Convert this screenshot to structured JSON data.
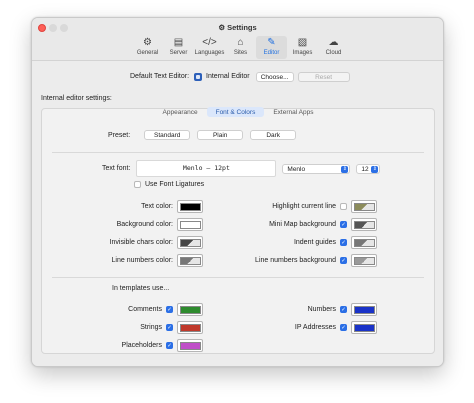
{
  "window": {
    "title": "Settings"
  },
  "toolbar": [
    {
      "label": "General",
      "icon": "gear-icon",
      "glyph": "⚙"
    },
    {
      "label": "Server",
      "icon": "server-icon",
      "glyph": "▤"
    },
    {
      "label": "Languages",
      "icon": "code-icon",
      "glyph": "</>"
    },
    {
      "label": "Sites",
      "icon": "house-icon",
      "glyph": "⌂"
    },
    {
      "label": "Editor",
      "icon": "editor-icon",
      "glyph": "✎",
      "active": true
    },
    {
      "label": "Images",
      "icon": "image-icon",
      "glyph": "▧"
    },
    {
      "label": "Cloud",
      "icon": "cloud-icon",
      "glyph": "☁"
    }
  ],
  "editor": {
    "default_label": "Default Text Editor:",
    "default_value": "Internal Editor",
    "choose": "Choose...",
    "reset": "Reset",
    "internal_settings": "Internal editor settings:"
  },
  "tabs": [
    "Appearance",
    "Font & Colors",
    "External Apps"
  ],
  "preset": {
    "label": "Preset:",
    "options": [
      "Standard",
      "Plain",
      "Dark"
    ]
  },
  "font": {
    "label": "Text font:",
    "preview": "Menlo — 12pt",
    "family": "Menlo",
    "size": "12",
    "ligatures": "Use Font Ligatures"
  },
  "colors_left": [
    {
      "label": "Text color:",
      "color": "#000000"
    },
    {
      "label": "Background color:",
      "color": "#ffffff"
    },
    {
      "label": "Invisible chars color:",
      "color": "#444444",
      "gradient": true
    },
    {
      "label": "Line numbers color:",
      "color": "#777777",
      "gradient": true
    }
  ],
  "colors_right": [
    {
      "label": "Highlight current line",
      "checked": false,
      "color": "#8b8b5a",
      "gradient": true
    },
    {
      "label": "Mini Map background",
      "checked": true,
      "color": "#555555",
      "gradient": true
    },
    {
      "label": "Indent guides",
      "checked": true,
      "color": "#777777",
      "gradient": true
    },
    {
      "label": "Line numbers background",
      "checked": true,
      "color": "#999999",
      "gradient": true
    }
  ],
  "templates": {
    "heading": "In templates use...",
    "left": [
      {
        "label": "Comments",
        "checked": true,
        "color": "#2e8b2e"
      },
      {
        "label": "Strings",
        "checked": true,
        "color": "#c0392b"
      },
      {
        "label": "Placeholders",
        "checked": true,
        "color": "#c04fc8"
      }
    ],
    "right": [
      {
        "label": "Numbers",
        "checked": true,
        "color": "#1a33c8"
      },
      {
        "label": "IP Addresses",
        "checked": true,
        "color": "#1a33c8"
      }
    ]
  }
}
